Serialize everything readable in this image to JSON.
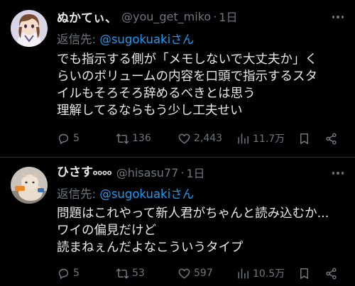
{
  "tweets": [
    {
      "display_name": "ぬかてぃ、",
      "handle": "@you_get_miko",
      "separator": "·",
      "time": "1日",
      "reply_prefix": "返信先: ",
      "reply_mention": "@sugokuaki",
      "reply_suffix": "さん",
      "lines": [
        "でも指示する側が「メモしないで大丈夫か」く",
        "らいのボリュームの内容を口頭で指示するスタ",
        "イルもそろそろ辞めるべきとは思う",
        "理解してるならもう少し工夫せい"
      ],
      "replies": "5",
      "retweets": "136",
      "likes": "2,443",
      "views": "11.7万"
    },
    {
      "display_name": "ひさす৹৹৹৹",
      "handle": "@hisasu77",
      "separator": "·",
      "time": "1日",
      "reply_prefix": "返信先: ",
      "reply_mention": "@sugokuaki",
      "reply_suffix": "さん",
      "lines": [
        "問題はこれやって新人君がちゃんと読み込むか...",
        "ワイの偏見だけど",
        "読まねぇんだよなこういうタイプ"
      ],
      "replies": "5",
      "retweets": "53",
      "likes": "597",
      "views": "10.5万"
    }
  ],
  "icons": [
    "reply-icon",
    "retweet-icon",
    "like-icon",
    "views-icon",
    "bookmark-icon",
    "share-icon",
    "more-icon"
  ],
  "colors": {
    "background": "#000000",
    "text": "#e7e9ea",
    "muted": "#71767b",
    "link": "#1d9bf0",
    "divider": "#2f3336"
  }
}
